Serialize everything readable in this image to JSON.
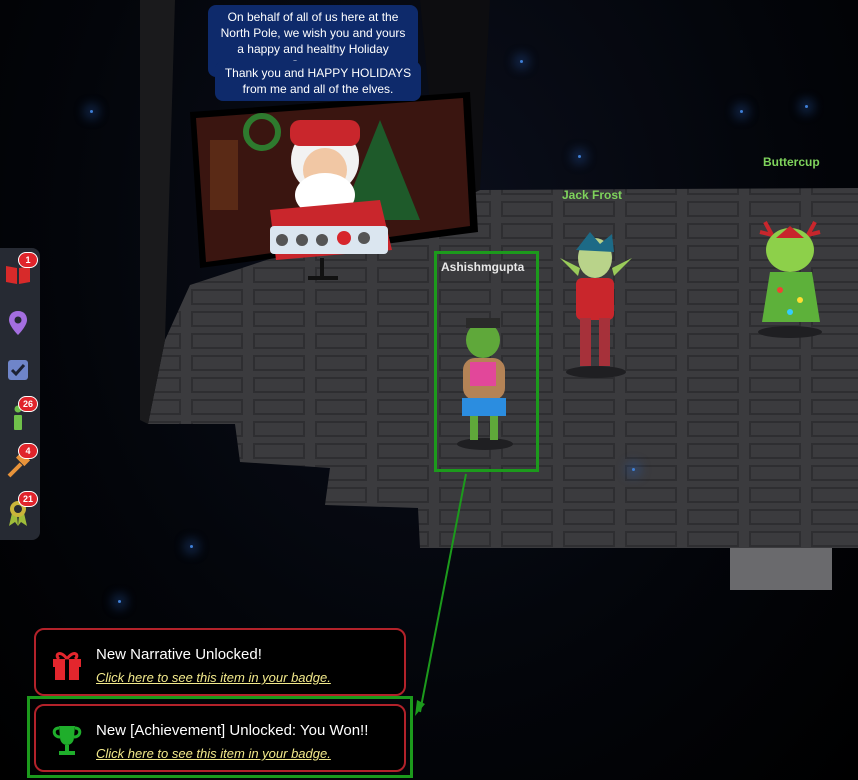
{
  "chat": {
    "message_1": "On behalf of all of us here at the North Pole, we wish you and yours a happy and healthy Holiday Season.",
    "message_2": "Thank you and HAPPY HOLIDAYS from me and all of the elves."
  },
  "characters": {
    "player": "Ashishmgupta",
    "npc_1": "Jack Frost",
    "npc_2": "Buttercup"
  },
  "sidebar": {
    "items": [
      {
        "icon": "book-icon",
        "badge": "1"
      },
      {
        "icon": "map-pin-icon",
        "badge": ""
      },
      {
        "icon": "checklist-icon",
        "badge": ""
      },
      {
        "icon": "info-icon",
        "badge": "26"
      },
      {
        "icon": "hammer-icon",
        "badge": "4"
      },
      {
        "icon": "achievement-icon",
        "badge": "21"
      }
    ]
  },
  "notifications": [
    {
      "icon": "gift-icon",
      "title": "New Narrative Unlocked!",
      "link": "Click here to see this item in your badge."
    },
    {
      "icon": "trophy-icon",
      "title": "New [Achievement] Unlocked: You Won!!",
      "link": "Click here to see this item in your badge."
    }
  ],
  "colors": {
    "accent_green": "#7fd35c",
    "highlight_green": "#1c9a1c",
    "alert_red": "#e0242b",
    "bubble_blue": "#0e2a6b"
  }
}
